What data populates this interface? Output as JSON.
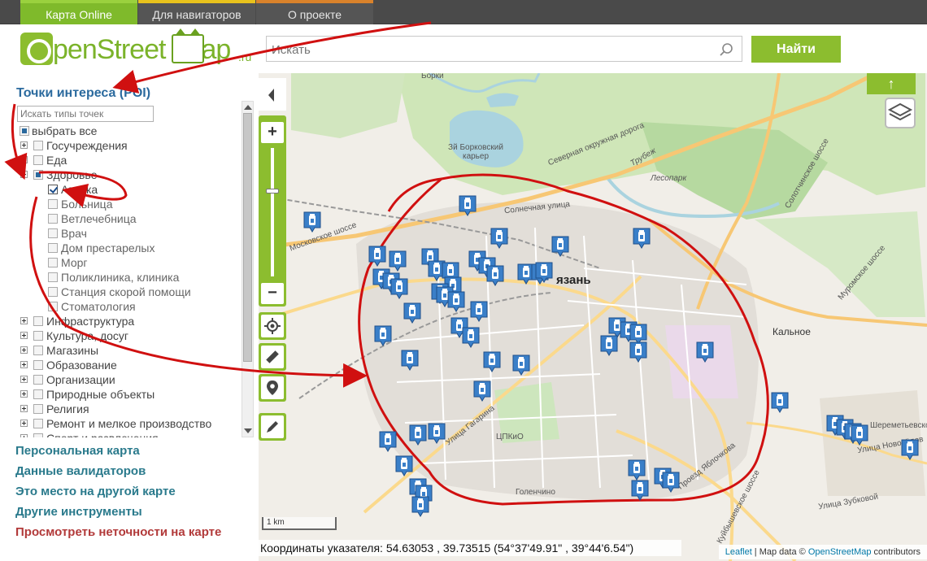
{
  "topnav": {
    "tabs": [
      "Карта Online",
      "Для навигаторов",
      "О проекте"
    ]
  },
  "header": {
    "logo_text": "penStreet",
    "logo_suffix": "ap",
    "logo_domain": ".ru",
    "search_placeholder": "Искать",
    "find_label": "Найти"
  },
  "panel": {
    "title": "Точки интереса (POI)",
    "search_placeholder": "Искать типы точек",
    "select_all": "выбрать все",
    "categories": {
      "gov": "Госучреждения",
      "food": "Еда",
      "health": "Здоровье",
      "health_items": [
        "Аптека",
        "Больница",
        "Ветлечебница",
        "Врач",
        "Дом престарелых",
        "Морг",
        "Поликлиника, клиника",
        "Станция скорой помощи",
        "Стоматология"
      ],
      "rest": [
        "Инфраструктура",
        "Культура, досуг",
        "Магазины",
        "Образование",
        "Организации",
        "Природные объекты",
        "Религия",
        "Ремонт и мелкое производство",
        "Спорт и развлечения"
      ]
    },
    "links": [
      "Персональная карта",
      "Данные валидаторов",
      "Это место на другой карте",
      "Другие инструменты",
      "Просмотреть неточности на карте"
    ]
  },
  "map": {
    "labels": {
      "city": "язань",
      "kalnoe": "Кальное",
      "lake": "Зй Борковский карьер",
      "borki": "Борки",
      "lesopark": "Лесопарк",
      "tsp": "ЦПКиО",
      "golenchino": "Голенчино",
      "sherem": "Шереметьевское",
      "novosel": "Улица Новосёлов",
      "zubkovoy": "Улица Зубковой",
      "yablochkova": "Проезд Яблочкова",
      "kuibysh": "Куйбышевское шоссе",
      "solnech": "Солнечная улица",
      "sev_okr": "Северная окружная дорога",
      "muromskoe": "Муромское шоссе",
      "solotch": "Солотчинское шоссе",
      "gagarina": "Улица Гагарина",
      "troitsk": "Трубеж",
      "mosk_shosse": "Московское шоссе"
    },
    "scale": "1 km",
    "coords": "Координаты указателя: 54.63053 , 39.73515 (54°37'49.91\" , 39°44'6.54\")",
    "attrib_leaflet": "Leaflet",
    "attrib_mid": " | Map data © ",
    "attrib_osm": "OpenStreetMap",
    "attrib_end": " contributors",
    "btn_top": "↑",
    "colors": {
      "accent": "#8cbd2f",
      "poi": "#3a7fc8",
      "annotation": "#d01010"
    }
  }
}
